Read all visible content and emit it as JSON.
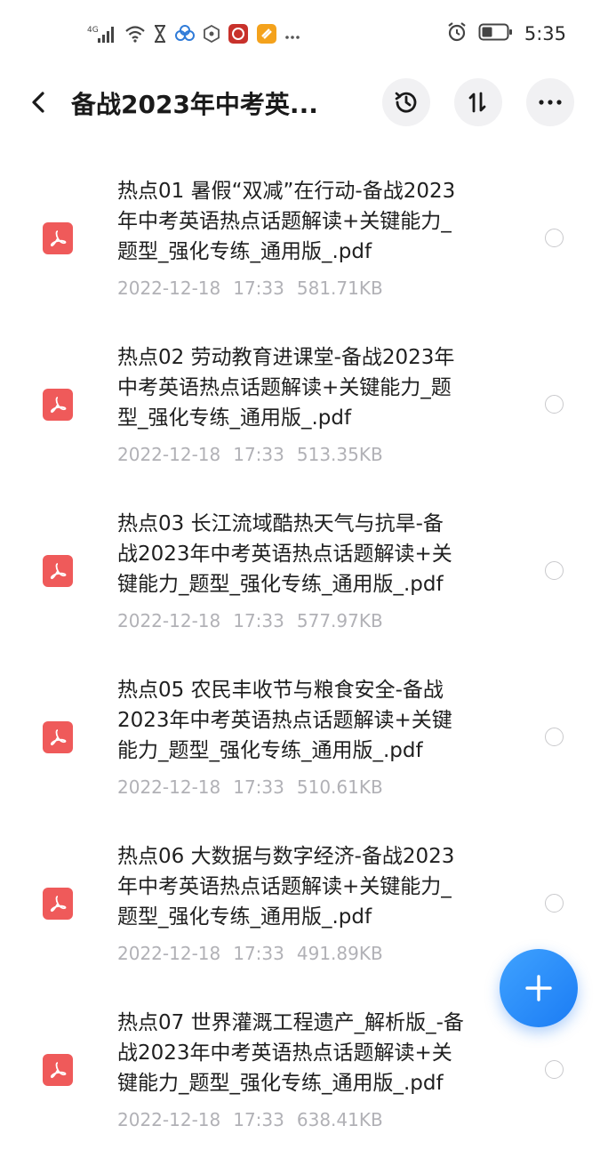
{
  "status_bar": {
    "network": "4G",
    "time": "5:35",
    "icons": [
      "signal-icon",
      "wifi-icon",
      "hourglass-icon",
      "app-cluster-icon",
      "hexagon-icon",
      "app-red-icon",
      "app-orange-icon",
      "more-dots-icon",
      "alarm-icon",
      "battery-icon"
    ]
  },
  "header": {
    "title": "备战2023年中考英...",
    "icons": [
      "back-icon",
      "history-icon",
      "sort-icon",
      "more-icon"
    ]
  },
  "files": [
    {
      "lines": [
        "热点01 暑假“双减”在行动-备战2023",
        "年中考英语热点话题解读+关键能力_",
        "题型_强化专练_通用版_.pdf"
      ],
      "date": "2022-12-18",
      "time": "17:33",
      "size": "581.71KB"
    },
    {
      "lines": [
        "热点02 劳动教育进课堂-备战2023年",
        "中考英语热点话题解读+关键能力_题",
        "型_强化专练_通用版_.pdf"
      ],
      "date": "2022-12-18",
      "time": "17:33",
      "size": "513.35KB"
    },
    {
      "lines": [
        "热点03 长江流域酷热天气与抗旱-备",
        "战2023年中考英语热点话题解读+关",
        "键能力_题型_强化专练_通用版_.pdf"
      ],
      "date": "2022-12-18",
      "time": "17:33",
      "size": "577.97KB"
    },
    {
      "lines": [
        "热点05 农民丰收节与粮食安全-备战",
        "2023年中考英语热点话题解读+关键",
        "能力_题型_强化专练_通用版_.pdf"
      ],
      "date": "2022-12-18",
      "time": "17:33",
      "size": "510.61KB"
    },
    {
      "lines": [
        "热点06 大数据与数字经济-备战2023",
        "年中考英语热点话题解读+关键能力_",
        "题型_强化专练_通用版_.pdf"
      ],
      "date": "2022-12-18",
      "time": "17:33",
      "size": "491.89KB"
    },
    {
      "lines": [
        "热点07 世界灌溉工程遗产_解析版_-备",
        "战2023年中考英语热点话题解读+关",
        "键能力_题型_强化专练_通用版_.pdf"
      ],
      "date": "2022-12-18",
      "time": "17:33",
      "size": "638.41KB"
    }
  ],
  "fab": {
    "icon": "plus-icon"
  },
  "colors": {
    "pdf": "#ef5a5a",
    "accent": "#1b7cf4",
    "meta": "#b1b1b6"
  }
}
